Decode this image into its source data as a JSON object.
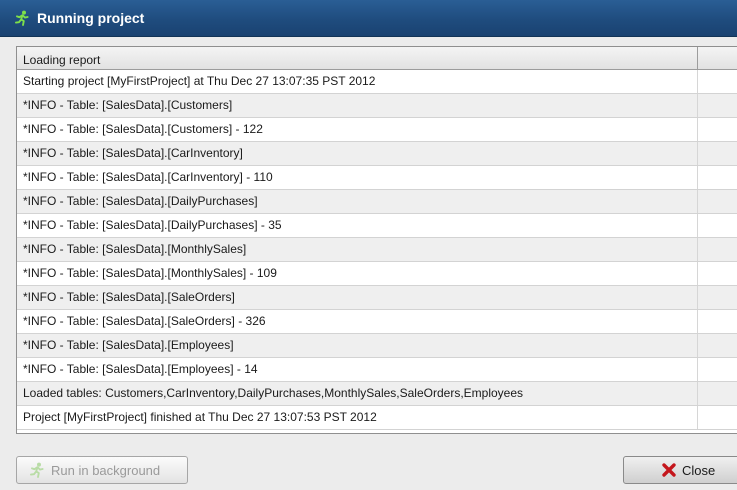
{
  "window": {
    "title": "Running project",
    "title_icon": "running-man-icon",
    "accent_color": "#1f4c7e"
  },
  "report": {
    "column_header": "Loading report",
    "rows": [
      "Starting project [MyFirstProject] at Thu Dec 27 13:07:35 PST 2012",
      "*INFO - Table: [SalesData].[Customers]",
      "*INFO - Table: [SalesData].[Customers] - 122",
      "*INFO - Table: [SalesData].[CarInventory]",
      "*INFO - Table: [SalesData].[CarInventory] - 110",
      "*INFO - Table: [SalesData].[DailyPurchases]",
      "*INFO - Table: [SalesData].[DailyPurchases] - 35",
      "*INFO - Table: [SalesData].[MonthlySales]",
      "*INFO - Table: [SalesData].[MonthlySales] - 109",
      "*INFO - Table: [SalesData].[SaleOrders]",
      "*INFO - Table: [SalesData].[SaleOrders] - 326",
      "*INFO - Table: [SalesData].[Employees]",
      "*INFO - Table: [SalesData].[Employees] - 14",
      "Loaded tables: Customers,CarInventory,DailyPurchases,MonthlySales,SaleOrders,Employees",
      "Project [MyFirstProject] finished at Thu Dec 27 13:07:53 PST 2012"
    ]
  },
  "buttons": {
    "run_background_label": "Run in background",
    "run_background_icon": "running-man-icon",
    "close_label": "Close",
    "close_icon": "red-x-icon"
  }
}
